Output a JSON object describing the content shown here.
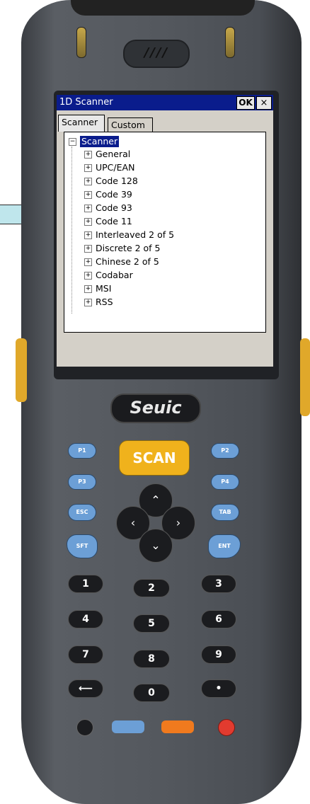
{
  "window": {
    "title": "1D Scanner",
    "ok_label": "OK",
    "close_label": "×"
  },
  "tabs": [
    {
      "label": "Scanner",
      "active": true
    },
    {
      "label": "Custom",
      "active": false
    }
  ],
  "tree": {
    "root": {
      "label": "Scanner",
      "expander": "⊟"
    },
    "items": [
      {
        "label": "General",
        "expander": "+"
      },
      {
        "label": "UPC/EAN",
        "expander": "+"
      },
      {
        "label": "Code 128",
        "expander": "+"
      },
      {
        "label": "Code 39",
        "expander": "+"
      },
      {
        "label": "Code 93",
        "expander": "+"
      },
      {
        "label": "Code 11",
        "expander": "+"
      },
      {
        "label": "Interleaved 2 of 5",
        "expander": "+"
      },
      {
        "label": "Discrete 2 of 5",
        "expander": "+"
      },
      {
        "label": "Chinese 2 of 5",
        "expander": "+"
      },
      {
        "label": "Codabar",
        "expander": "+"
      },
      {
        "label": "MSI",
        "expander": "+"
      },
      {
        "label": "RSS",
        "expander": "+"
      }
    ]
  },
  "device": {
    "brand": "Seuic",
    "speaker_mark": "////",
    "keys": {
      "p1": "P1",
      "p2": "P2",
      "p3": "P3",
      "p4": "P4",
      "scan": "SCAN",
      "esc": "ESC",
      "tab": "TAB",
      "sft": "SFT",
      "ent": "ENT",
      "k1": "1",
      "k2": "2",
      "k3": "3",
      "k4": "4",
      "k5": "5",
      "k6": "6",
      "k7": "7",
      "k8": "8",
      "k9": "9",
      "k0": "0",
      "dot": "•",
      "bksp": "⟵"
    },
    "colors": {
      "scan_key": "#f0b21c",
      "blue_keys": "#6c9fd6",
      "power_key": "#e23b2f",
      "orange_key": "#f07a1e",
      "titlebar": "#0a1c8c"
    }
  }
}
